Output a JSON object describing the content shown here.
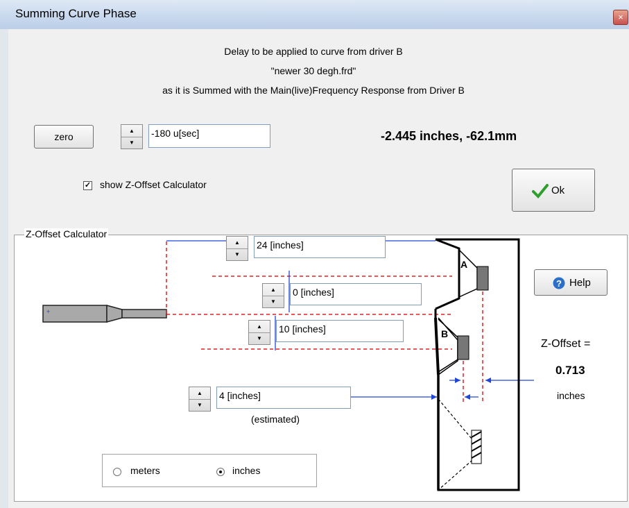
{
  "window": {
    "title": "Summing Curve Phase",
    "close_glyph": "×"
  },
  "message": {
    "line1": "Delay to be applied to curve from driver B",
    "line2": "\"newer 30 degh.frd\"",
    "line3": "as it is Summed with the Main(live)Frequency Response from Driver B"
  },
  "delay": {
    "zero_label": "zero",
    "value": "-180 u[sec]",
    "distance_readout": "-2.445 inches, -62.1mm"
  },
  "show_calc": {
    "label": "show Z-Offset Calculator",
    "checked": true
  },
  "ok_button": {
    "label": "Ok",
    "icon": "checkmark-icon"
  },
  "calculator": {
    "legend": "Z-Offset Calculator",
    "mic_distance": "24 [inches]",
    "offset_a": "0 [inches]",
    "offset_b": "10 [inches]",
    "baffle_depth": "4 [inches]",
    "estimated_label": "(estimated)",
    "help_label": "Help",
    "help_icon": "question-icon",
    "driver_a_label": "A",
    "driver_b_label": "B",
    "zoffset_label": "Z-Offset =",
    "zoffset_value": "0.713",
    "zoffset_units": "inches",
    "units": {
      "meters": "meters",
      "inches": "inches",
      "selected": "inches"
    }
  },
  "colors": {
    "accent_blue": "#2046d8",
    "guide_red": "#e02020",
    "ok_green": "#2e9e2e"
  }
}
